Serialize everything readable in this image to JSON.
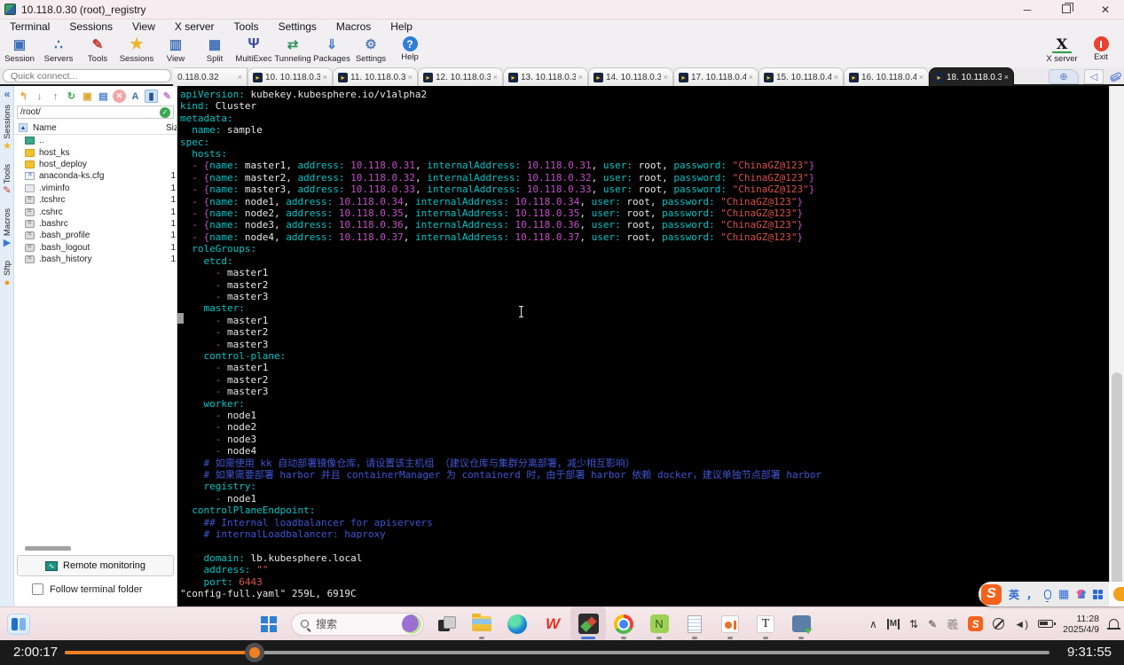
{
  "titlebar": {
    "title": "10.118.0.30 (root)_registry"
  },
  "menubar": {
    "items": [
      "Terminal",
      "Sessions",
      "View",
      "X server",
      "Tools",
      "Settings",
      "Macros",
      "Help"
    ]
  },
  "toolbar": {
    "left": [
      {
        "label": "Session",
        "icon": "session",
        "glyph": "▣"
      },
      {
        "label": "Servers",
        "icon": "servers",
        "glyph": "∴"
      },
      {
        "label": "Tools",
        "icon": "tools",
        "glyph": "✎"
      },
      {
        "label": "Sessions",
        "icon": "star",
        "glyph": "★"
      },
      {
        "label": "View",
        "icon": "view",
        "glyph": "▥"
      },
      {
        "label": "Split",
        "icon": "split",
        "glyph": "▦"
      },
      {
        "label": "MultiExec",
        "icon": "multiexec",
        "glyph": "Ψ"
      },
      {
        "label": "Tunneling",
        "icon": "tunneling",
        "glyph": "⇄"
      },
      {
        "label": "Packages",
        "icon": "packages",
        "glyph": "⇓"
      },
      {
        "label": "Settings",
        "icon": "settings",
        "glyph": "⚙"
      },
      {
        "label": "Help",
        "icon": "help",
        "glyph": "?"
      }
    ],
    "right": [
      {
        "label": "X server",
        "icon": "xserver",
        "glyph": "X"
      },
      {
        "label": "Exit",
        "icon": "exit",
        "glyph": ""
      }
    ]
  },
  "quick_connect": {
    "placeholder": "Quick connect..."
  },
  "tabbar": {
    "tabs": [
      {
        "label": "0.118.0.32",
        "active": false,
        "clipped": true
      },
      {
        "label": "10. 10.118.0.3",
        "active": false
      },
      {
        "label": "11. 10.118.0.3",
        "active": false
      },
      {
        "label": "12. 10.118.0.3",
        "active": false
      },
      {
        "label": "13. 10.118.0.3",
        "active": false
      },
      {
        "label": "14. 10.118.0.3",
        "active": false
      },
      {
        "label": "17. 10.118.0.4",
        "active": false
      },
      {
        "label": "15. 10.118.0.4",
        "active": false
      },
      {
        "label": "16. 10.118.0.4",
        "active": false
      },
      {
        "label": "18. 10.118.0.3",
        "active": true
      }
    ],
    "new_tab_glyph": "⊕",
    "prev_tab_glyph": "◁"
  },
  "sidebar": {
    "collapse_glyph": "«",
    "vertical_tabs": [
      {
        "label": "Sessions",
        "icon": "star",
        "glyph": "★"
      },
      {
        "label": "Tools",
        "icon": "tools",
        "glyph": "✎"
      },
      {
        "label": "Macros",
        "icon": "plane",
        "glyph": "▶"
      },
      {
        "label": "Sftp",
        "icon": "dot",
        "glyph": "●"
      }
    ],
    "sftp": {
      "toolbar": [
        {
          "name": "parent-dir",
          "glyph": "↰"
        },
        {
          "name": "download",
          "glyph": "↓"
        },
        {
          "name": "upload",
          "glyph": "↑"
        },
        {
          "name": "refresh",
          "glyph": "↻"
        },
        {
          "name": "new-folder",
          "glyph": "▣"
        },
        {
          "name": "new-file",
          "glyph": "▤"
        },
        {
          "name": "delete",
          "glyph": "✕"
        },
        {
          "name": "rename",
          "glyph": "A"
        },
        {
          "name": "panel-toggle",
          "glyph": "▮"
        },
        {
          "name": "edit",
          "glyph": "✎"
        }
      ],
      "path": "/root/",
      "path_ok_glyph": "✓",
      "columns": {
        "name": "Name",
        "size": "Siz"
      },
      "files": [
        {
          "name": "..",
          "type": "folder-up",
          "size": ""
        },
        {
          "name": "host_ks",
          "type": "folder",
          "size": ""
        },
        {
          "name": "host_deploy",
          "type": "folder",
          "size": ""
        },
        {
          "name": "anaconda-ks.cfg",
          "type": "cfg",
          "size": "1"
        },
        {
          "name": ".viminfo",
          "type": "file",
          "size": "1"
        },
        {
          "name": ".tcshrc",
          "type": "script",
          "size": "1"
        },
        {
          "name": ".cshrc",
          "type": "script",
          "size": "1"
        },
        {
          "name": ".bashrc",
          "type": "script",
          "size": "1"
        },
        {
          "name": ".bash_profile",
          "type": "script",
          "size": "1"
        },
        {
          "name": ".bash_logout",
          "type": "script",
          "size": "1"
        },
        {
          "name": ".bash_history",
          "type": "script",
          "size": "1"
        }
      ],
      "remote_monitoring_label": "Remote monitoring",
      "follow_label": "Follow terminal folder",
      "follow_checked": false
    }
  },
  "terminal": {
    "lines": [
      [
        [
          "k",
          "apiVersion:"
        ],
        [
          "w",
          " kubekey.kubesphere.io/v1alpha2"
        ]
      ],
      [
        [
          "k",
          "kind:"
        ],
        [
          "w",
          " Cluster"
        ]
      ],
      [
        [
          "k",
          "metadata:"
        ]
      ],
      [
        [
          "w",
          "  "
        ],
        [
          "k",
          "name:"
        ],
        [
          "w",
          " sample"
        ]
      ],
      [
        [
          "k",
          "spec:"
        ]
      ],
      [
        [
          "w",
          "  "
        ],
        [
          "k",
          "hosts:"
        ]
      ],
      [
        [
          "w",
          "  "
        ],
        [
          "m",
          "- {"
        ],
        [
          "k",
          "name:"
        ],
        [
          "w",
          " master1, "
        ],
        [
          "k",
          "address:"
        ],
        [
          "w",
          " "
        ],
        [
          "m",
          "10.118.0.31"
        ],
        [
          "w",
          ", "
        ],
        [
          "k",
          "internalAddress:"
        ],
        [
          "w",
          " "
        ],
        [
          "m",
          "10.118.0.31"
        ],
        [
          "w",
          ", "
        ],
        [
          "k",
          "user:"
        ],
        [
          "w",
          " root, "
        ],
        [
          "k",
          "password:"
        ],
        [
          "w",
          " "
        ],
        [
          "r",
          "\"ChinaGZ@123\""
        ],
        [
          "m",
          "}"
        ]
      ],
      [
        [
          "w",
          "  "
        ],
        [
          "m",
          "- {"
        ],
        [
          "k",
          "name:"
        ],
        [
          "w",
          " master2, "
        ],
        [
          "k",
          "address:"
        ],
        [
          "w",
          " "
        ],
        [
          "m",
          "10.118.0.32"
        ],
        [
          "w",
          ", "
        ],
        [
          "k",
          "internalAddress:"
        ],
        [
          "w",
          " "
        ],
        [
          "m",
          "10.118.0.32"
        ],
        [
          "w",
          ", "
        ],
        [
          "k",
          "user:"
        ],
        [
          "w",
          " root, "
        ],
        [
          "k",
          "password:"
        ],
        [
          "w",
          " "
        ],
        [
          "r",
          "\"ChinaGZ@123\""
        ],
        [
          "m",
          "}"
        ]
      ],
      [
        [
          "w",
          "  "
        ],
        [
          "m",
          "- {"
        ],
        [
          "k",
          "name:"
        ],
        [
          "w",
          " master3, "
        ],
        [
          "k",
          "address:"
        ],
        [
          "w",
          " "
        ],
        [
          "m",
          "10.118.0.33"
        ],
        [
          "w",
          ", "
        ],
        [
          "k",
          "internalAddress:"
        ],
        [
          "w",
          " "
        ],
        [
          "m",
          "10.118.0.33"
        ],
        [
          "w",
          ", "
        ],
        [
          "k",
          "user:"
        ],
        [
          "w",
          " root, "
        ],
        [
          "k",
          "password:"
        ],
        [
          "w",
          " "
        ],
        [
          "r",
          "\"ChinaGZ@123\""
        ],
        [
          "m",
          "}"
        ]
      ],
      [
        [
          "w",
          "  "
        ],
        [
          "m",
          "- {"
        ],
        [
          "k",
          "name:"
        ],
        [
          "w",
          " node1, "
        ],
        [
          "k",
          "address:"
        ],
        [
          "w",
          " "
        ],
        [
          "m",
          "10.118.0.34"
        ],
        [
          "w",
          ", "
        ],
        [
          "k",
          "internalAddress:"
        ],
        [
          "w",
          " "
        ],
        [
          "m",
          "10.118.0.34"
        ],
        [
          "w",
          ", "
        ],
        [
          "k",
          "user:"
        ],
        [
          "w",
          " root, "
        ],
        [
          "k",
          "password:"
        ],
        [
          "w",
          " "
        ],
        [
          "r",
          "\"ChinaGZ@123\""
        ],
        [
          "m",
          "}"
        ]
      ],
      [
        [
          "w",
          "  "
        ],
        [
          "m",
          "- {"
        ],
        [
          "k",
          "name:"
        ],
        [
          "w",
          " node2, "
        ],
        [
          "k",
          "address:"
        ],
        [
          "w",
          " "
        ],
        [
          "m",
          "10.118.0.35"
        ],
        [
          "w",
          ", "
        ],
        [
          "k",
          "internalAddress:"
        ],
        [
          "w",
          " "
        ],
        [
          "m",
          "10.118.0.35"
        ],
        [
          "w",
          ", "
        ],
        [
          "k",
          "user:"
        ],
        [
          "w",
          " root, "
        ],
        [
          "k",
          "password:"
        ],
        [
          "w",
          " "
        ],
        [
          "r",
          "\"ChinaGZ@123\""
        ],
        [
          "m",
          "}"
        ]
      ],
      [
        [
          "w",
          "  "
        ],
        [
          "m",
          "- {"
        ],
        [
          "k",
          "name:"
        ],
        [
          "w",
          " node3, "
        ],
        [
          "k",
          "address:"
        ],
        [
          "w",
          " "
        ],
        [
          "m",
          "10.118.0.36"
        ],
        [
          "w",
          ", "
        ],
        [
          "k",
          "internalAddress:"
        ],
        [
          "w",
          " "
        ],
        [
          "m",
          "10.118.0.36"
        ],
        [
          "w",
          ", "
        ],
        [
          "k",
          "user:"
        ],
        [
          "w",
          " root, "
        ],
        [
          "k",
          "password:"
        ],
        [
          "w",
          " "
        ],
        [
          "r",
          "\"ChinaGZ@123\""
        ],
        [
          "m",
          "}"
        ]
      ],
      [
        [
          "w",
          "  "
        ],
        [
          "m",
          "- {"
        ],
        [
          "k",
          "name:"
        ],
        [
          "w",
          " node4, "
        ],
        [
          "k",
          "address:"
        ],
        [
          "w",
          " "
        ],
        [
          "m",
          "10.118.0.37"
        ],
        [
          "w",
          ", "
        ],
        [
          "k",
          "internalAddress:"
        ],
        [
          "w",
          " "
        ],
        [
          "m",
          "10.118.0.37"
        ],
        [
          "w",
          ", "
        ],
        [
          "k",
          "user:"
        ],
        [
          "w",
          " root, "
        ],
        [
          "k",
          "password:"
        ],
        [
          "w",
          " "
        ],
        [
          "r",
          "\"ChinaGZ@123\""
        ],
        [
          "m",
          "}"
        ]
      ],
      [
        [
          "w",
          "  "
        ],
        [
          "k",
          "roleGroups:"
        ]
      ],
      [
        [
          "w",
          "    "
        ],
        [
          "k",
          "etcd:"
        ]
      ],
      [
        [
          "w",
          "      "
        ],
        [
          "m",
          "- "
        ],
        [
          "w",
          "master1"
        ]
      ],
      [
        [
          "w",
          "      "
        ],
        [
          "m",
          "- "
        ],
        [
          "w",
          "master2"
        ]
      ],
      [
        [
          "w",
          "      "
        ],
        [
          "m",
          "- "
        ],
        [
          "w",
          "master3"
        ]
      ],
      [
        [
          "w",
          "    "
        ],
        [
          "k",
          "master:"
        ]
      ],
      [
        [
          "w",
          "      "
        ],
        [
          "m",
          "- "
        ],
        [
          "w",
          "master1"
        ]
      ],
      [
        [
          "w",
          "      "
        ],
        [
          "m",
          "- "
        ],
        [
          "w",
          "master2"
        ]
      ],
      [
        [
          "w",
          "      "
        ],
        [
          "m",
          "- "
        ],
        [
          "w",
          "master3"
        ]
      ],
      [
        [
          "w",
          "    "
        ],
        [
          "k",
          "control-plane:"
        ]
      ],
      [
        [
          "w",
          "      "
        ],
        [
          "m",
          "- "
        ],
        [
          "w",
          "master1"
        ]
      ],
      [
        [
          "w",
          "      "
        ],
        [
          "m",
          "- "
        ],
        [
          "w",
          "master2"
        ]
      ],
      [
        [
          "w",
          "      "
        ],
        [
          "m",
          "- "
        ],
        [
          "w",
          "master3"
        ]
      ],
      [
        [
          "w",
          "    "
        ],
        [
          "k",
          "worker:"
        ]
      ],
      [
        [
          "w",
          "      "
        ],
        [
          "m",
          "- "
        ],
        [
          "w",
          "node1"
        ]
      ],
      [
        [
          "w",
          "      "
        ],
        [
          "m",
          "- "
        ],
        [
          "w",
          "node2"
        ]
      ],
      [
        [
          "w",
          "      "
        ],
        [
          "m",
          "- "
        ],
        [
          "w",
          "node3"
        ]
      ],
      [
        [
          "w",
          "      "
        ],
        [
          "m",
          "- "
        ],
        [
          "w",
          "node4"
        ]
      ],
      [
        [
          "b",
          "    # 如需使用 kk 自动部署镜像仓库，请设置该主机组 （建议仓库与集群分离部署，减少相互影响）"
        ]
      ],
      [
        [
          "b",
          "    # 如果需要部署 harbor 并且 containerManager 为 containerd 时，由于部署 harbor 依赖 docker，建议单独节点部署 harbor"
        ]
      ],
      [
        [
          "w",
          "    "
        ],
        [
          "k",
          "registry:"
        ]
      ],
      [
        [
          "w",
          "      "
        ],
        [
          "m",
          "- "
        ],
        [
          "w",
          "node1"
        ]
      ],
      [
        [
          "w",
          "  "
        ],
        [
          "k",
          "controlPlaneEndpoint:"
        ]
      ],
      [
        [
          "b",
          "    ## Internal loadbalancer for apiservers"
        ]
      ],
      [
        [
          "b",
          "    # internalLoadbalancer: haproxy"
        ]
      ],
      [],
      [
        [
          "w",
          "    "
        ],
        [
          "k",
          "domain:"
        ],
        [
          "w",
          " lb.kubesphere.local"
        ]
      ],
      [
        [
          "w",
          "    "
        ],
        [
          "k",
          "address:"
        ],
        [
          "w",
          " "
        ],
        [
          "r",
          "\"\""
        ]
      ],
      [
        [
          "w",
          "    "
        ],
        [
          "k",
          "port:"
        ],
        [
          "w",
          " "
        ],
        [
          "r",
          "6443"
        ]
      ],
      [
        [
          "w",
          "\"config-full.yaml\" 259L, 6919C"
        ]
      ]
    ]
  },
  "taskbar": {
    "search_text": "搜索",
    "wps_glyph": "W",
    "npp_glyph": "N",
    "typora_glyph": "T",
    "tray_chevron": "∧",
    "m_badge": "M",
    "mixer_glyph": "⇅",
    "pen_glyph": "✎",
    "seal_glyph": "羲",
    "sogou_glyph": "S",
    "volume_glyph": "◄)",
    "clock_time": "11:28",
    "clock_date": "2025/4/9"
  },
  "ime": {
    "logo": "S",
    "mode": "英",
    "punct": "，"
  },
  "player": {
    "elapsed": "2:00:17",
    "total": "9:31:55",
    "progress_pct": 19.3
  }
}
